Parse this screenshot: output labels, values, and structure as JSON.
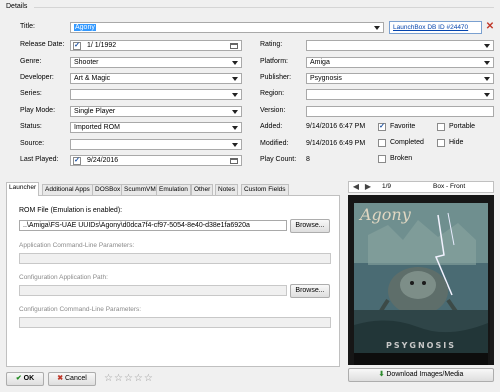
{
  "details": {
    "group_label": "Details",
    "title_label": "Title:",
    "title_value": "Agony",
    "db_link": "LaunchBox DB ID #24470",
    "release_date_label": "Release Date:",
    "release_date_value": "1/  1/1992",
    "rating_label": "Rating:",
    "rating_value": "",
    "genre_label": "Genre:",
    "genre_value": "Shooter",
    "platform_label": "Platform:",
    "platform_value": "Amiga",
    "developer_label": "Developer:",
    "developer_value": "Art & Magic",
    "publisher_label": "Publisher:",
    "publisher_value": "Psygnosis",
    "series_label": "Series:",
    "series_value": "",
    "region_label": "Region:",
    "region_value": "",
    "playmode_label": "Play Mode:",
    "playmode_value": "Single Player",
    "version_label": "Version:",
    "version_value": "",
    "status_label": "Status:",
    "status_value": "Imported ROM",
    "added_label": "Added:",
    "added_value": "9/14/2016 6:47 PM",
    "source_label": "Source:",
    "source_value": "",
    "modified_label": "Modified:",
    "modified_value": "9/14/2016 6:49 PM",
    "lastplayed_label": "Last Played:",
    "lastplayed_value": "9/24/2016",
    "playcount_label": "Play Count:",
    "playcount_value": "8",
    "favorite_label": "Favorite",
    "portable_label": "Portable",
    "completed_label": "Completed",
    "hide_label": "Hide",
    "broken_label": "Broken"
  },
  "tabs": [
    {
      "label": "Launcher"
    },
    {
      "label": "Additional Apps"
    },
    {
      "label": "DOSBox"
    },
    {
      "label": "ScummVM"
    },
    {
      "label": "Emulation"
    },
    {
      "label": "Other"
    },
    {
      "label": "Notes"
    },
    {
      "label": "Custom Fields"
    }
  ],
  "launcher": {
    "rom_label": "ROM File (Emulation is enabled):",
    "rom_value": "..\\Amiga\\FS-UAE UUIDs\\Agony\\d0dca7f4-cf97-5054-8e40-d38e1fa6920a",
    "browse": "Browse...",
    "app_params_label": "Application Command-Line Parameters:",
    "config_path_label": "Configuration Application Path:",
    "config_params_label": "Configuration Command-Line Parameters:"
  },
  "image_panel": {
    "page_indicator": "1/9",
    "image_type": "Box - Front",
    "download_label": "Download Images/Media",
    "cover_title": "Agony",
    "cover_publisher": "PSYGNOSIS"
  },
  "footer": {
    "ok": "OK",
    "cancel": "Cancel",
    "stars": [
      "☆",
      "☆",
      "☆",
      "☆",
      "☆"
    ]
  },
  "colors": {
    "selection": "#3399ff",
    "link": "#0645ad"
  }
}
